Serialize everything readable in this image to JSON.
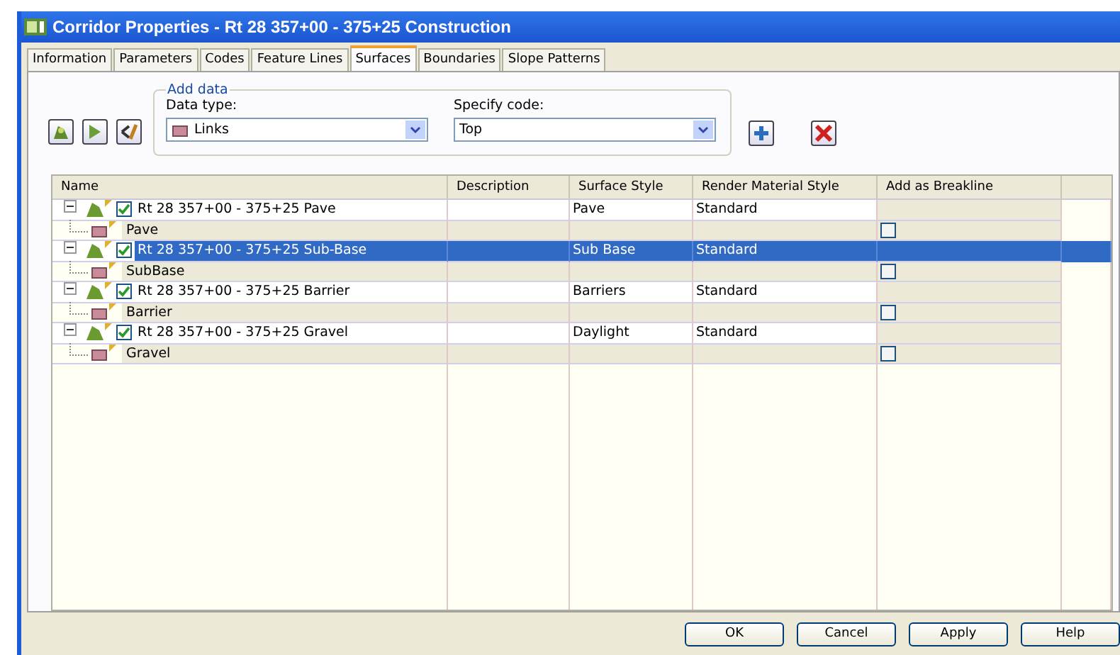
{
  "window": {
    "title": "Corridor Properties - Rt 28 357+00 - 375+25 Construction"
  },
  "tabs": [
    {
      "label": "Information",
      "selected": false
    },
    {
      "label": "Parameters",
      "selected": false
    },
    {
      "label": "Codes",
      "selected": false
    },
    {
      "label": "Feature Lines",
      "selected": false
    },
    {
      "label": "Surfaces",
      "selected": true
    },
    {
      "label": "Boundaries",
      "selected": false
    },
    {
      "label": "Slope Patterns",
      "selected": false
    }
  ],
  "add_data": {
    "title": "Add data",
    "data_type_label": "Data type:",
    "data_type": "Links",
    "code_label": "Specify code:",
    "code": "Top"
  },
  "table": {
    "columns": [
      "Name",
      "Description",
      "Surface Style",
      "Render Material Style",
      "Add as Breakline"
    ],
    "rows": [
      {
        "name": "Rt 28 357+00 - 375+25 Pave",
        "checked": true,
        "expanded": true,
        "selected": false,
        "surface_style": "Pave",
        "render_material_style": "Standard",
        "children": [
          {
            "name": "Pave",
            "add_as_breakline": false
          }
        ]
      },
      {
        "name": "Rt 28 357+00 - 375+25 Sub-Base",
        "checked": true,
        "expanded": true,
        "selected": true,
        "surface_style": "Sub Base",
        "render_material_style": "Standard",
        "children": [
          {
            "name": "SubBase",
            "add_as_breakline": false
          }
        ]
      },
      {
        "name": "Rt 28 357+00 - 375+25 Barrier",
        "checked": true,
        "expanded": true,
        "selected": false,
        "surface_style": "Barriers",
        "render_material_style": "Standard",
        "children": [
          {
            "name": "Barrier",
            "add_as_breakline": false
          }
        ]
      },
      {
        "name": "Rt 28 357+00 - 375+25 Gravel",
        "checked": true,
        "expanded": true,
        "selected": false,
        "surface_style": "Daylight",
        "render_material_style": "Standard",
        "children": [
          {
            "name": "Gravel",
            "add_as_breakline": false
          }
        ]
      }
    ]
  },
  "buttons": [
    "OK",
    "Cancel",
    "Apply",
    "Help"
  ]
}
